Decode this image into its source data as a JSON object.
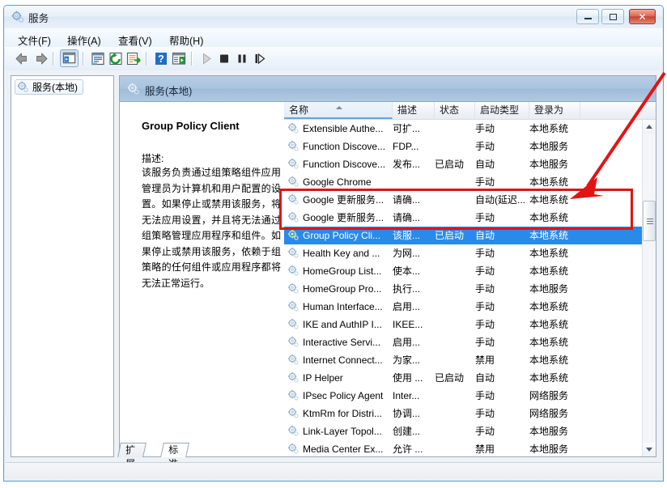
{
  "window": {
    "title": "服务",
    "icon": "services-gear-icon",
    "caption_buttons": {
      "minimize": "最小化",
      "maximize": "最大化",
      "close": "关闭",
      "close_glyph": "✕"
    }
  },
  "menubar": {
    "items": [
      {
        "label": "文件(F)",
        "name": "menu-file"
      },
      {
        "label": "操作(A)",
        "name": "menu-action"
      },
      {
        "label": "查看(V)",
        "name": "menu-view"
      },
      {
        "label": "帮助(H)",
        "name": "menu-help"
      }
    ]
  },
  "toolbar": {
    "buttons": [
      {
        "name": "back-icon",
        "title": "后退"
      },
      {
        "name": "forward-icon",
        "title": "前进"
      },
      {
        "name": "show-hide-tree-icon",
        "title": "显示/隐藏控制台树",
        "pressed": true
      },
      {
        "name": "properties-icon",
        "title": "属性"
      },
      {
        "name": "refresh-icon",
        "title": "刷新"
      },
      {
        "name": "export-list-icon",
        "title": "导出列表"
      },
      {
        "name": "help-icon",
        "title": "帮助"
      },
      {
        "name": "show-action-pane-icon",
        "title": "显示/隐藏操作窗格"
      },
      {
        "name": "start-service-icon",
        "title": "启动服务"
      },
      {
        "name": "stop-service-icon",
        "title": "停止服务"
      },
      {
        "name": "pause-service-icon",
        "title": "暂停服务"
      },
      {
        "name": "restart-service-icon",
        "title": "重启服务"
      }
    ]
  },
  "tree": {
    "root_label": "服务(本地)",
    "root_icon": "services-gear-icon"
  },
  "pane": {
    "header_label": "服务(本地)",
    "header_icon": "services-gear-icon"
  },
  "details": {
    "service_title": "Group Policy Client",
    "description_label": "描述:",
    "description_text": "该服务负责通过组策略组件应用管理员为计算机和用户配置的设置。如果停止或禁用该服务，将无法应用设置，并且将无法通过组策略管理应用程序和组件。如果停止或禁用该服务，依赖于组策略的任何组件或应用程序都将无法正常运行。"
  },
  "list": {
    "columns": [
      {
        "label": "名称",
        "name": "column-name",
        "sorted": true,
        "sort_direction": "ascending"
      },
      {
        "label": "描述",
        "name": "column-description",
        "sorted": false
      },
      {
        "label": "状态",
        "name": "column-status",
        "sorted": false
      },
      {
        "label": "启动类型",
        "name": "column-startup-type",
        "sorted": false
      },
      {
        "label": "登录为",
        "name": "column-log-on-as",
        "sorted": false
      }
    ],
    "rows": [
      {
        "name": "Extensible Authe...",
        "description": "可扩...",
        "status": "",
        "startup": "手动",
        "logon": "本地系统",
        "selected": false,
        "highlighted": false
      },
      {
        "name": "Function Discove...",
        "description": "FDP...",
        "status": "",
        "startup": "手动",
        "logon": "本地服务",
        "selected": false,
        "highlighted": false
      },
      {
        "name": "Function Discove...",
        "description": "发布...",
        "status": "已启动",
        "startup": "自动",
        "logon": "本地服务",
        "selected": false,
        "highlighted": false
      },
      {
        "name": "Google Chrome",
        "description": "",
        "status": "",
        "startup": "手动",
        "logon": "本地系统",
        "selected": false,
        "highlighted": false
      },
      {
        "name": "Google 更新服务...",
        "description": "请确...",
        "status": "",
        "startup": "自动(延迟...",
        "logon": "本地系统",
        "selected": false,
        "highlighted": true
      },
      {
        "name": "Google 更新服务...",
        "description": "请确...",
        "status": "",
        "startup": "手动",
        "logon": "本地系统",
        "selected": false,
        "highlighted": true
      },
      {
        "name": "Group Policy Cli...",
        "description": "该服...",
        "status": "已启动",
        "startup": "自动",
        "logon": "本地系统",
        "selected": true,
        "highlighted": false
      },
      {
        "name": "Health Key and ...",
        "description": "为网...",
        "status": "",
        "startup": "手动",
        "logon": "本地系统",
        "selected": false,
        "highlighted": false
      },
      {
        "name": "HomeGroup List...",
        "description": "使本...",
        "status": "",
        "startup": "手动",
        "logon": "本地系统",
        "selected": false,
        "highlighted": false
      },
      {
        "name": "HomeGroup Pro...",
        "description": "执行...",
        "status": "",
        "startup": "手动",
        "logon": "本地服务",
        "selected": false,
        "highlighted": false
      },
      {
        "name": "Human Interface...",
        "description": "启用...",
        "status": "",
        "startup": "手动",
        "logon": "本地系统",
        "selected": false,
        "highlighted": false
      },
      {
        "name": "IKE and AuthIP I...",
        "description": "IKEE...",
        "status": "",
        "startup": "手动",
        "logon": "本地系统",
        "selected": false,
        "highlighted": false
      },
      {
        "name": "Interactive Servi...",
        "description": "启用...",
        "status": "",
        "startup": "手动",
        "logon": "本地系统",
        "selected": false,
        "highlighted": false
      },
      {
        "name": "Internet Connect...",
        "description": "为家...",
        "status": "",
        "startup": "禁用",
        "logon": "本地系统",
        "selected": false,
        "highlighted": false
      },
      {
        "name": "IP Helper",
        "description": "使用 ...",
        "status": "已启动",
        "startup": "自动",
        "logon": "本地系统",
        "selected": false,
        "highlighted": false
      },
      {
        "name": "IPsec Policy Agent",
        "description": "Inter...",
        "status": "",
        "startup": "手动",
        "logon": "网络服务",
        "selected": false,
        "highlighted": false
      },
      {
        "name": "KtmRm for Distri...",
        "description": "协调...",
        "status": "",
        "startup": "手动",
        "logon": "网络服务",
        "selected": false,
        "highlighted": false
      },
      {
        "name": "Link-Layer Topol...",
        "description": "创建...",
        "status": "",
        "startup": "手动",
        "logon": "本地服务",
        "selected": false,
        "highlighted": false
      },
      {
        "name": "Media Center Ex...",
        "description": "允许 ...",
        "status": "",
        "startup": "禁用",
        "logon": "本地服务",
        "selected": false,
        "highlighted": false
      }
    ]
  },
  "scrollbar": {
    "up_arrow": "scroll-up-icon",
    "down_arrow": "scroll-down-icon"
  },
  "tabs": [
    {
      "label": "扩展",
      "name": "tab-extended",
      "active": false
    },
    {
      "label": "标准",
      "name": "tab-standard",
      "active": true
    }
  ],
  "annotations": {
    "highlight_rect_color": "#e11414",
    "arrow_color": "#e11414"
  }
}
